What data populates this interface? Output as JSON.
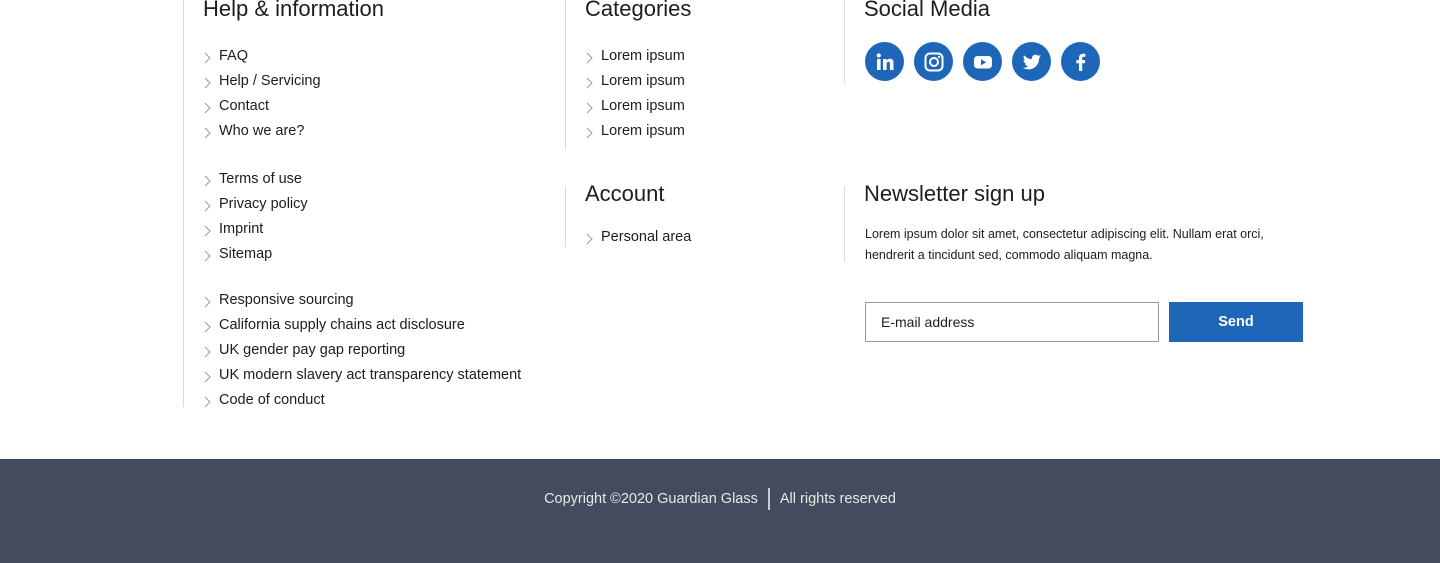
{
  "help": {
    "heading": "Help & information",
    "group1": [
      "FAQ",
      "Help / Servicing",
      "Contact",
      "Who we are?"
    ],
    "group2": [
      "Terms of use",
      "Privacy policy",
      "Imprint",
      "Sitemap"
    ],
    "group3": [
      "Responsive sourcing",
      "California supply chains act disclosure",
      "UK gender pay gap reporting",
      "UK modern slavery act transparency statement",
      "Code of conduct"
    ]
  },
  "categories": {
    "heading": "Categories",
    "items": [
      "Lorem ipsum",
      "Lorem ipsum",
      "Lorem ipsum",
      "Lorem ipsum"
    ]
  },
  "account": {
    "heading": "Account",
    "items": [
      "Personal area"
    ]
  },
  "social": {
    "heading": "Social Media",
    "icons": [
      "linkedin-icon",
      "instagram-icon",
      "youtube-icon",
      "twitter-icon",
      "facebook-icon"
    ],
    "color": "#1e66b8"
  },
  "newsletter": {
    "heading": "Newsletter sign up",
    "text": "Lorem ipsum dolor sit amet, consectetur adipiscing elit. Nullam erat orci, hendrerit a tincidunt sed, commodo aliquam magna.",
    "email_placeholder": "E-mail address",
    "send_label": "Send"
  },
  "footer": {
    "copyright": "Copyright ©2020 Guardian Glass",
    "rights": "All rights reserved",
    "background": "#434c5e"
  }
}
